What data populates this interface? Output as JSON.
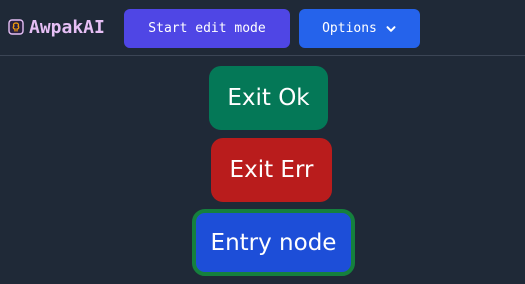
{
  "app": {
    "title": "AwpakAI",
    "logo_icon": "brain-logo-icon"
  },
  "toolbar": {
    "edit_label": "Start edit mode",
    "options_label": "Options",
    "options_icon": "chevron-down-icon"
  },
  "graph": {
    "nodes": [
      {
        "label": "Exit Ok",
        "color": "#047857"
      },
      {
        "label": "Exit Err",
        "color": "#b91c1c"
      },
      {
        "label": "Entry node",
        "color": "#1d4ed8",
        "border_color": "#15803d"
      }
    ]
  },
  "colors": {
    "background": "#1f2937",
    "brand_text": "#e6bff5",
    "edit_button": "#4f46e5",
    "options_button": "#2563eb"
  }
}
